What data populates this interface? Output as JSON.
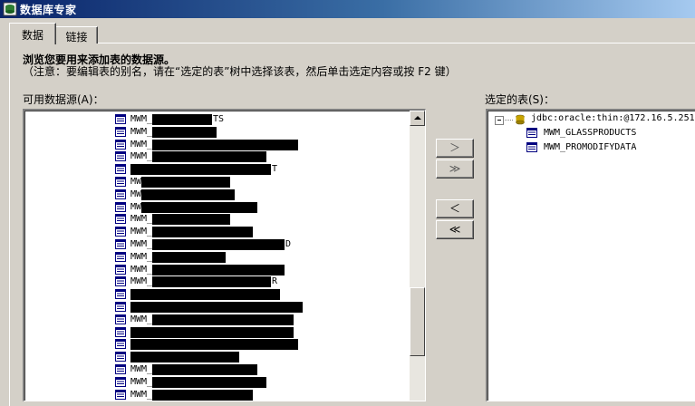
{
  "window": {
    "title": "数据库专家"
  },
  "tabs": [
    {
      "label": "数据"
    },
    {
      "label": "链接"
    }
  ],
  "instructions": {
    "title": "浏览您要用来添加表的数据源。",
    "body": "（注意：要编辑表的别名，请在“选定的表”树中选择该表，然后单击选定内容或按 F2 键）"
  },
  "available": {
    "label": "可用数据源(A)：",
    "items": [
      {
        "text": "MWM_",
        "tail": "TS",
        "w": 90
      },
      {
        "text": "MWM_",
        "w": 95
      },
      {
        "text": "MWM_",
        "w": 185
      },
      {
        "text": "MWM_",
        "w": 150
      },
      {
        "text": "",
        "tail": "T",
        "w": 155
      },
      {
        "text": "MW",
        "w": 110
      },
      {
        "text": "MW",
        "w": 115
      },
      {
        "text": "MW",
        "w": 140
      },
      {
        "text": "MWM_",
        "w": 110
      },
      {
        "text": "MWM_",
        "w": 135
      },
      {
        "text": "MWM_",
        "tail": "D",
        "w": 170
      },
      {
        "text": "MWM_",
        "w": 105
      },
      {
        "text": "MWM_",
        "w": 170
      },
      {
        "text": "MWM_",
        "tail": "R",
        "w": 155
      },
      {
        "text": "",
        "w": 165
      },
      {
        "text": "",
        "w": 190
      },
      {
        "text": "MWM_",
        "w": 180
      },
      {
        "text": "",
        "w": 180
      },
      {
        "text": "",
        "w": 185
      },
      {
        "text": "",
        "w": 120
      },
      {
        "text": "MWM_",
        "w": 140
      },
      {
        "text": "MWM_",
        "w": 150
      },
      {
        "text": "MWM_",
        "w": 135
      },
      {
        "text": "MWM_",
        "w": 115
      }
    ]
  },
  "buttons": {
    "add": "＞",
    "add_all": "≫",
    "remove": "＜",
    "remove_all": "≪"
  },
  "selected": {
    "label": "选定的表(S)：",
    "connection": "jdbc:oracle:thin:@172.16.5.251",
    "tables": [
      "MWM_GLASSPRODUCTS",
      "MWM_PROMODIFYDATA"
    ]
  }
}
